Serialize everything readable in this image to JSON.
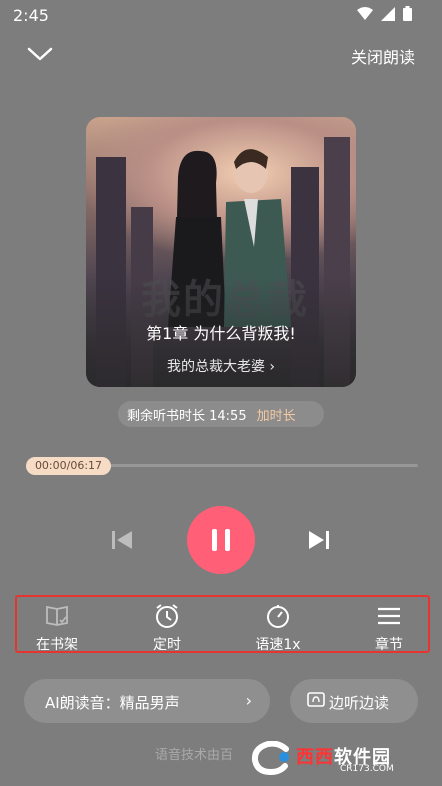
{
  "status_bar": {
    "time": "2:45"
  },
  "top_bar": {
    "close_label": "关闭朗读"
  },
  "cover": {
    "art_title": "我的总裁",
    "chapter_title": "第1章 为什么背叛我!",
    "book_title": "我的总裁大老婆 ›"
  },
  "remaining": {
    "label": "剩余听书时长 14:55",
    "add_label": "加时长"
  },
  "progress": {
    "time_text": "00:00/06:17",
    "fraction": 0.0
  },
  "tools": [
    {
      "label": "在书架"
    },
    {
      "label": "定时"
    },
    {
      "label": "语速1x"
    },
    {
      "label": "章节"
    }
  ],
  "voice": {
    "label": "AI朗读音：精品男声",
    "arrow": "›"
  },
  "listen": {
    "label": "边听边读"
  },
  "footer": {
    "note": "语音技术由百"
  },
  "watermark": {
    "brand_a": "西西",
    "brand_b": "软件园",
    "url": "CR173.COM"
  },
  "colors": {
    "background": "#7d7d7d",
    "accent": "#ff5f77",
    "highlight_box": "#e5352e",
    "pill": "#f6dcc5"
  }
}
